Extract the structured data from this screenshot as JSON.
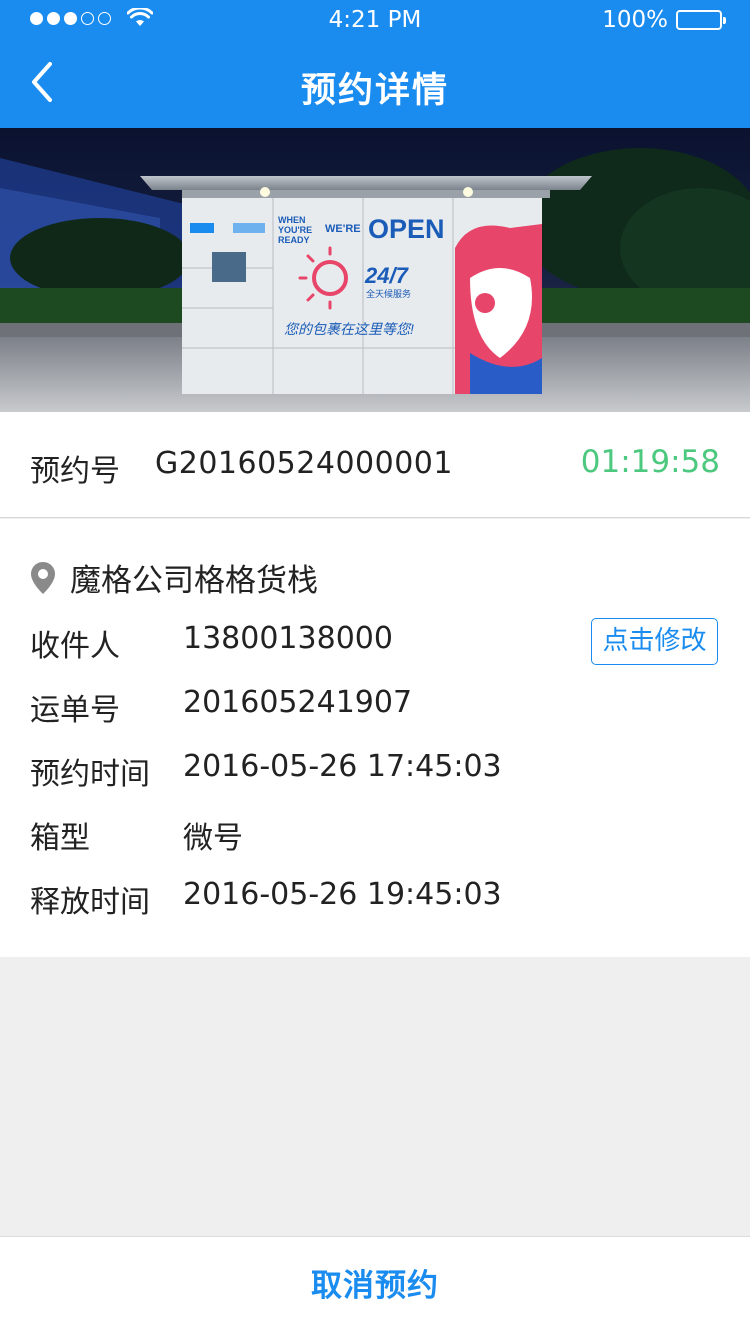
{
  "status_bar": {
    "time": "4:21 PM",
    "battery": "100%"
  },
  "nav": {
    "title": "预约详情"
  },
  "hero": {
    "sign_when": "WHEN",
    "sign_youre": "YOU'RE",
    "sign_ready": "READY",
    "sign_were": "WE'RE",
    "sign_open": "OPEN",
    "sign_247": "24/7",
    "sign_service": "全天候服务",
    "sign_slogan": "您的包裹在这里等您!"
  },
  "booking": {
    "label": "预约号",
    "number": "G20160524000001",
    "countdown": "01:19:58"
  },
  "details": {
    "location": "魔格公司格格货栈",
    "edit_label": "点击修改",
    "rows": [
      {
        "key": "收件人",
        "value": "13800138000"
      },
      {
        "key": "运单号",
        "value": "201605241907"
      },
      {
        "key": "预约时间",
        "value": "2016-05-26 17:45:03"
      },
      {
        "key": "箱型",
        "value": "微号"
      },
      {
        "key": "释放时间",
        "value": "2016-05-26 19:45:03"
      }
    ]
  },
  "bottom": {
    "cancel_label": "取消预约"
  },
  "colors": {
    "primary": "#1a8cf0",
    "timer": "#4cc97e",
    "background": "#efefef"
  },
  "icons": {
    "back": "chevron-left-icon",
    "location": "location-pin-icon",
    "wifi": "wifi-icon",
    "battery": "battery-icon"
  }
}
